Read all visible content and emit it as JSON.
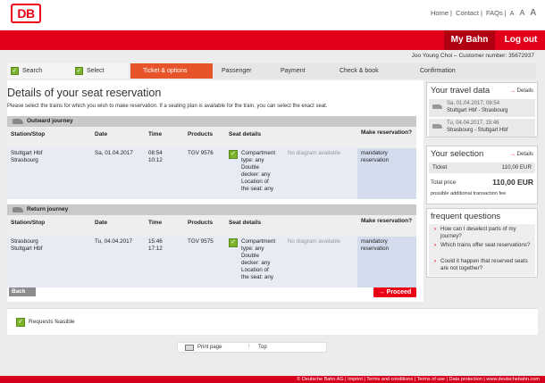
{
  "header": {
    "logo_text": "DB",
    "links": [
      "Home",
      "Contact",
      "FAQs"
    ],
    "font_sizes": [
      "A",
      "A",
      "A"
    ],
    "mybahn": "My Bahn",
    "logout": "Log out"
  },
  "customer": "Joo Young Choi – Customer number: 35672937",
  "steps": [
    {
      "label": "Search",
      "state": "done"
    },
    {
      "label": "Select",
      "state": "done"
    },
    {
      "label": "Ticket & options",
      "state": "active"
    },
    {
      "label": "Passenger",
      "state": "todo"
    },
    {
      "label": "Payment",
      "state": "todo"
    },
    {
      "label": "Check & book",
      "state": "todo"
    },
    {
      "label": "Confirmation",
      "state": "todo"
    }
  ],
  "main": {
    "title": "Details of your seat reservation",
    "intro": "Please select the trains for which you wish to make reservation. If a seating plan is available for the train, you can select the exact seat.",
    "columns": [
      "Station/Stop",
      "Date",
      "Time",
      "Products",
      "Seat details",
      "Make reservation?"
    ],
    "outward": {
      "heading": "Outward journey",
      "stations": [
        "Stuttgart Hbf",
        "Strasbourg"
      ],
      "date": "Sa, 01.04.2017",
      "times": [
        "08:54",
        "10:12"
      ],
      "product": "TGV 9576",
      "seat": [
        "Compartment",
        "type: any",
        "Double",
        "decker: any",
        "Location of",
        "the seat: any"
      ],
      "diagram": "No diagram available",
      "reservation": [
        "mandatory",
        "reservation"
      ]
    },
    "return": {
      "heading": "Return journey",
      "stations": [
        "Strasbourg",
        "Stuttgart Hbf"
      ],
      "date": "Tu, 04.04.2017",
      "times": [
        "15:46",
        "17:12"
      ],
      "product": "TGV 9575",
      "seat": [
        "Compartment",
        "type: any",
        "Double",
        "decker: any",
        "Location of",
        "the seat: any"
      ],
      "diagram": "No diagram available",
      "reservation": [
        "mandatory",
        "reservation"
      ]
    },
    "back": "Back",
    "proceed": "Proceed"
  },
  "travel": {
    "title": "Your travel data",
    "details": "Details",
    "trips": [
      {
        "date": "Sa, 01.04.2017, 08:54",
        "route": "Stuttgart Hbf - Strasbourg"
      },
      {
        "date": "Tu, 04.04.2017, 15:46",
        "route": "Strasbourg - Stuttgart Hbf"
      }
    ]
  },
  "selection": {
    "title": "Your selection",
    "details": "Details",
    "ticket_label": "Ticket",
    "ticket_price": "110,00 EUR",
    "total_label": "Total price",
    "total_price": "110,00 EUR",
    "fee_note": "possible additional transaction fee"
  },
  "faq": {
    "title": "frequent questions",
    "items": [
      "How can I deselect parts of my journey?",
      "Which trains offer seat reservations?",
      "Could it happen that reserved seats are not together?"
    ]
  },
  "feasibility": "Requests feasible",
  "printbar": {
    "print": "Print page",
    "top": "Top"
  },
  "footer": "© Deutsche Bahn AG | Imprint | Terms and conditions | Terms of use | Data protection | www.deutschebahn.com",
  "colors": {
    "brand_red": "#ec0016",
    "step_active": "#e8542a",
    "check_green": "#7cb32a"
  }
}
